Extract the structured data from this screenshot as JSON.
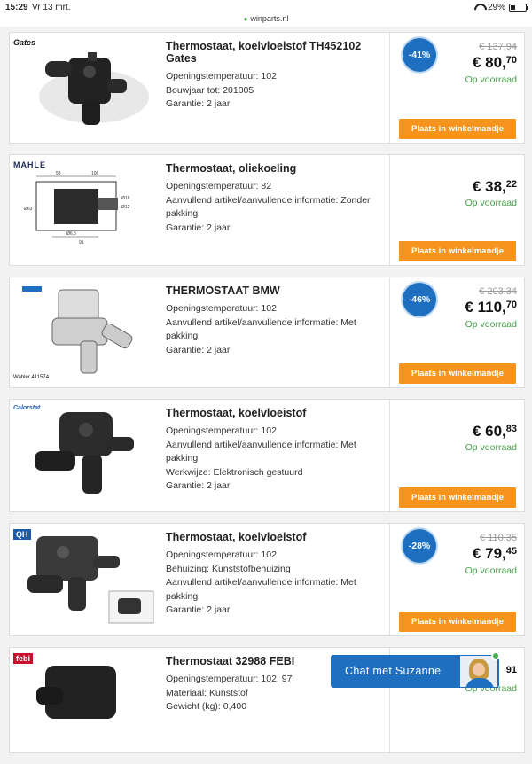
{
  "status": {
    "time": "15:29",
    "date": "Vr 13 mrt.",
    "url": "winparts.nl",
    "battery": "29%",
    "battery_fraction": 0.29
  },
  "products": [
    {
      "brand": "Gates",
      "title": "Thermostaat, koelvloeistof TH452102 Gates",
      "specs": [
        "Openingstemperatuur: 102",
        "Bouwjaar tot: 201005",
        "Garantie: 2 jaar"
      ],
      "discount": "-41%",
      "old_price": "€ 137,94",
      "price_main": "€ 80,",
      "price_cents": "70",
      "stock": "Op voorraad",
      "cart_label": "Plaats in winkelmandje"
    },
    {
      "brand": "MAHLE",
      "title": "Thermostaat, oliekoeling",
      "specs": [
        "Openingstemperatuur: 82",
        "Aanvullend artikel/aanvullende informatie: Zonder pakking",
        "Garantie: 2 jaar"
      ],
      "discount": "",
      "old_price": "",
      "price_main": "€ 38,",
      "price_cents": "22",
      "stock": "Op voorraad",
      "cart_label": "Plaats in winkelmandje",
      "dims": [
        "58",
        "106",
        "Ø16",
        "Ø12",
        "Ø63",
        "Ø6,5",
        "91"
      ]
    },
    {
      "brand": "Wahler 411574",
      "title": "THERMOSTAAT BMW",
      "specs": [
        "Openingstemperatuur: 102",
        "Aanvullend artikel/aanvullende informatie: Met pakking",
        "Garantie: 2 jaar"
      ],
      "discount": "-46%",
      "old_price": "€ 203,34",
      "price_main": "€ 110,",
      "price_cents": "70",
      "stock": "Op voorraad",
      "cart_label": "Plaats in winkelmandje"
    },
    {
      "brand": "Calorstat",
      "title": "Thermostaat, koelvloeistof",
      "specs": [
        "Openingstemperatuur: 102",
        "Aanvullend artikel/aanvullende informatie: Met pakking",
        "Werkwijze: Elektronisch gestuurd",
        "Garantie: 2 jaar"
      ],
      "discount": "",
      "old_price": "",
      "price_main": "€ 60,",
      "price_cents": "83",
      "stock": "Op voorraad",
      "cart_label": "Plaats in winkelmandje"
    },
    {
      "brand": "QH",
      "title": "Thermostaat, koelvloeistof",
      "specs": [
        "Openingstemperatuur: 102",
        "Behuizing: Kunststofbehuizing",
        "Aanvullend artikel/aanvullende informatie: Met pakking",
        "Garantie: 2 jaar"
      ],
      "discount": "-28%",
      "old_price": "€ 110,35",
      "price_main": "€ 79,",
      "price_cents": "45",
      "stock": "Op voorraad",
      "cart_label": "Plaats in winkelmandje"
    },
    {
      "brand": "febi",
      "title": "Thermostaat 32988 FEBI",
      "specs": [
        "Openingstemperatuur: 102, 97",
        "Materiaal: Kunststof",
        "Gewicht (kg): 0,400"
      ],
      "price_cents": "91",
      "stock": "Op voorraad"
    }
  ],
  "chat": {
    "label": "Chat met Suzanne"
  },
  "colors": {
    "accent": "#1f6fc0",
    "cart": "#f7941d",
    "stock": "#43a047"
  }
}
